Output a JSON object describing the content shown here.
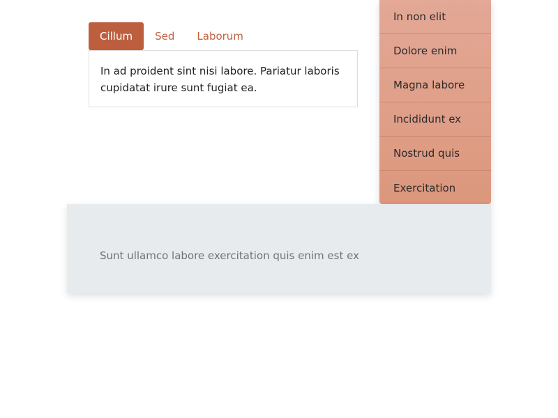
{
  "tabs": [
    {
      "label": "Cillum",
      "active": true
    },
    {
      "label": "Sed",
      "active": false
    },
    {
      "label": "Laborum",
      "active": false
    }
  ],
  "tab_panel": {
    "text": "In ad proident sint nisi labore. Pariatur laboris cupidatat irure sunt fugiat ea."
  },
  "menu": {
    "items": [
      {
        "label": "In non elit"
      },
      {
        "label": "Dolore enim"
      },
      {
        "label": "Magna labore"
      },
      {
        "label": "Incididunt ex"
      },
      {
        "label": "Nostrud quis"
      },
      {
        "label": "Exercitation"
      }
    ]
  },
  "card": {
    "text": "Sunt ullamco labore exercitation quis enim est ex"
  },
  "colors": {
    "accent": "#bd5f3f",
    "menu_background": "#e0a08a",
    "card_background": "#e8ebee"
  }
}
